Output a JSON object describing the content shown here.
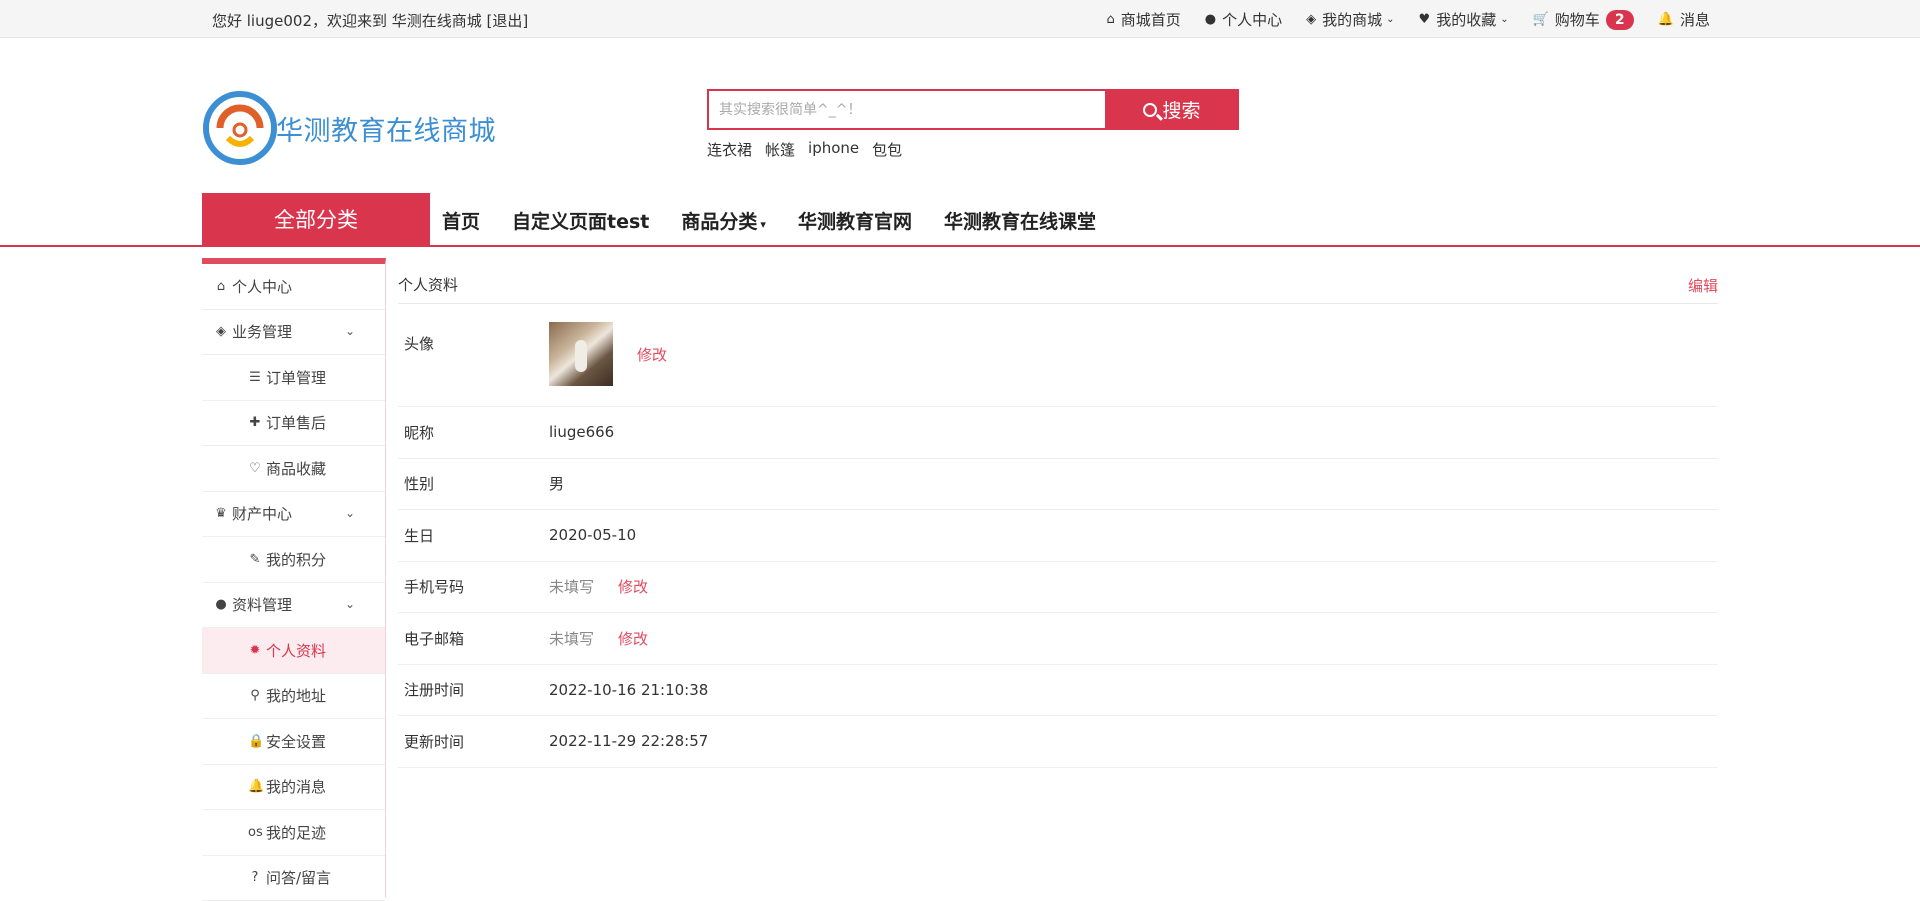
{
  "topbar": {
    "welcome": "您好 liuge002，欢迎来到 华测在线商城",
    "logout": "[退出]",
    "nav": [
      {
        "icon": "home-icon",
        "glyph": "⌂",
        "label": "商城首页"
      },
      {
        "icon": "user-icon",
        "glyph": "●",
        "label": "个人中心"
      },
      {
        "icon": "cube-icon",
        "glyph": "◈",
        "label": "我的商城",
        "caret": "⌄"
      },
      {
        "icon": "heart-icon",
        "glyph": "♥",
        "label": "我的收藏",
        "caret": "⌄"
      },
      {
        "icon": "cart-icon",
        "glyph": "🛒",
        "label": "购物车",
        "badge": "2"
      },
      {
        "icon": "bell-icon",
        "glyph": "🔔",
        "label": "消息"
      }
    ]
  },
  "header": {
    "logo_text": "华测教育在线商城",
    "search_placeholder": "其实搜索很简单^_^！",
    "search_button": "搜索",
    "hot_words": [
      "连衣裙",
      "帐篷",
      "iphone",
      "包包"
    ]
  },
  "mainnav": {
    "all_categories": "全部分类",
    "links": [
      "首页",
      "自定义页面test",
      "商品分类",
      "华测教育官网",
      "华测教育在线课堂"
    ],
    "dropdown_index": 2
  },
  "sidebar": {
    "items": [
      {
        "type": "top",
        "icon": "home-icon",
        "glyph": "⌂",
        "label": "个人中心"
      },
      {
        "type": "top",
        "icon": "cube-icon",
        "glyph": "◈",
        "label": "业务管理",
        "chevron": true
      },
      {
        "type": "sub",
        "icon": "list-icon",
        "glyph": "☰",
        "label": "订单管理"
      },
      {
        "type": "sub",
        "icon": "puzzle-icon",
        "glyph": "✚",
        "label": "订单售后"
      },
      {
        "type": "sub",
        "icon": "heart-outline-icon",
        "glyph": "♡",
        "label": "商品收藏"
      },
      {
        "type": "top",
        "icon": "trophy-icon",
        "glyph": "♛",
        "label": "财产中心",
        "chevron": true
      },
      {
        "type": "sub",
        "icon": "leaf-icon",
        "glyph": "✎",
        "label": "我的积分"
      },
      {
        "type": "top",
        "icon": "user-icon",
        "glyph": "●",
        "label": "资料管理",
        "chevron": true
      },
      {
        "type": "sub",
        "icon": "gear-icon",
        "glyph": "✹",
        "label": "个人资料",
        "active": true
      },
      {
        "type": "sub",
        "icon": "map-pin-icon",
        "glyph": "⚲",
        "label": "我的地址"
      },
      {
        "type": "sub",
        "icon": "lock-icon",
        "glyph": "🔒",
        "label": "安全设置"
      },
      {
        "type": "sub",
        "icon": "bell-outline-icon",
        "glyph": "🔔",
        "label": "我的消息"
      },
      {
        "type": "sub",
        "icon": "footprint-icon",
        "glyph": "ᴏs",
        "label": "我的足迹"
      },
      {
        "type": "sub",
        "icon": "question-icon",
        "glyph": "?",
        "label": "问答/留言"
      }
    ]
  },
  "profile": {
    "title": "个人资料",
    "edit": "编辑",
    "avatar_label": "头像",
    "avatar_modify": "修改",
    "rows": [
      {
        "label": "昵称",
        "value": "liuge666"
      },
      {
        "label": "性别",
        "value": "男"
      },
      {
        "label": "生日",
        "value": "2020-05-10"
      },
      {
        "label": "手机号码",
        "value": "未填写",
        "muted": true,
        "modify": "修改"
      },
      {
        "label": "电子邮箱",
        "value": "未填写",
        "muted": true,
        "modify": "修改"
      },
      {
        "label": "注册时间",
        "value": "2022-10-16 21:10:38"
      },
      {
        "label": "更新时间",
        "value": "2022-11-29 22:28:57"
      }
    ]
  },
  "colors": {
    "accent": "#d9364d",
    "logo_blue": "#3d8fd4"
  }
}
